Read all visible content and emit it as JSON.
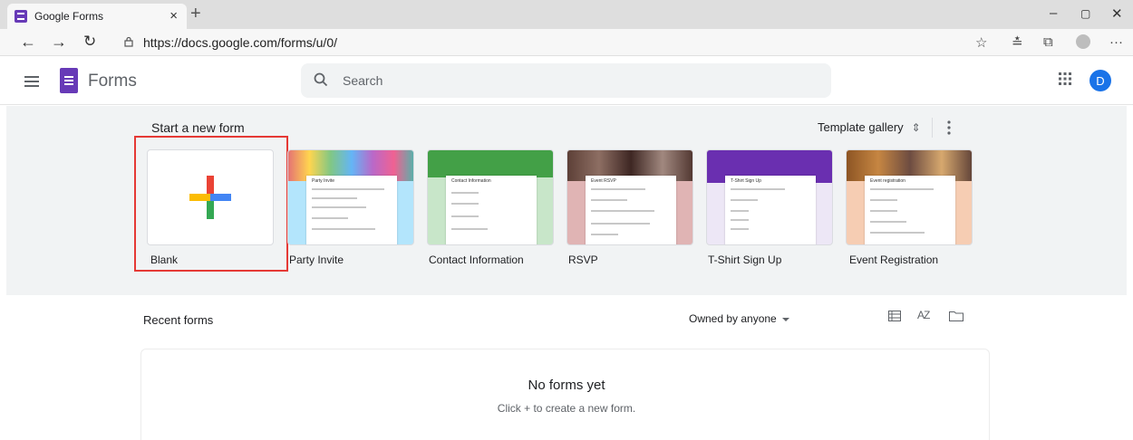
{
  "browser": {
    "tab_title": "Google Forms",
    "url": "https://docs.google.com/forms/u/0/"
  },
  "app": {
    "name": "Forms",
    "avatar_letter": "D",
    "brand_color": "#673ab7"
  },
  "search": {
    "placeholder": "Search"
  },
  "new_form": {
    "title": "Start a new form",
    "template_gallery_label": "Template gallery",
    "templates": [
      {
        "label": "Blank"
      },
      {
        "label": "Party Invite",
        "card_title": "Party Invite",
        "accent": "#b3e5fc"
      },
      {
        "label": "Contact Information",
        "card_title": "Contact Information",
        "accent": "#43a047"
      },
      {
        "label": "RSVP",
        "card_title": "Event RSVP",
        "accent": "#e0b4b4"
      },
      {
        "label": "T-Shirt Sign Up",
        "card_title": "T-Shirt Sign Up",
        "accent": "#6a2fb0"
      },
      {
        "label": "Event Registration",
        "card_title": "Event registration",
        "accent": "#f6cdb3"
      }
    ]
  },
  "recent": {
    "title": "Recent forms",
    "owner_filter": "Owned by anyone",
    "empty_title": "No forms yet",
    "empty_subtitle": "Click + to create a new form."
  }
}
